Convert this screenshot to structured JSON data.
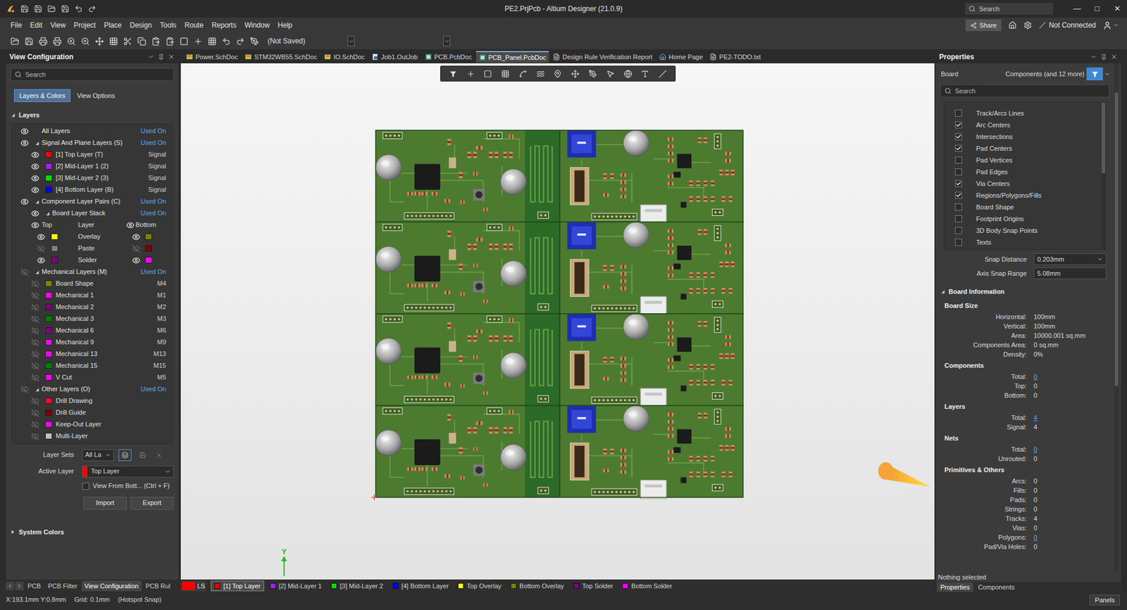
{
  "window": {
    "title": "PE2.PrjPcb - Altium Designer (21.0.9)",
    "search": "Search",
    "controls": [
      "—",
      "□",
      "✕"
    ]
  },
  "menu": [
    "File",
    "Edit",
    "View",
    "Project",
    "Place",
    "Design",
    "Tools",
    "Route",
    "Reports",
    "Window",
    "Help"
  ],
  "menu_right": {
    "share": "Share",
    "connection": "Not Connected"
  },
  "toolbar": {
    "document_state": "(Not Saved)"
  },
  "doc_tabs": [
    {
      "label": "Power.SchDoc",
      "kind": "sch",
      "selected": false
    },
    {
      "label": "STM32WB55.SchDoc",
      "kind": "sch",
      "selected": false
    },
    {
      "label": "IO.SchDoc",
      "kind": "sch",
      "selected": false
    },
    {
      "label": "Job1.OutJob",
      "kind": "outjob",
      "selected": false
    },
    {
      "label": "PCB.PcbDoc",
      "kind": "pcb",
      "selected": false
    },
    {
      "label": "PCB_Panel.PcbDoc",
      "kind": "pcb",
      "selected": true
    },
    {
      "label": "Design Rule Verification Report",
      "kind": "report",
      "selected": false
    },
    {
      "label": "Home Page",
      "kind": "home",
      "selected": false
    },
    {
      "label": "PE2-TODO.txt",
      "kind": "text",
      "selected": false
    }
  ],
  "left_panel": {
    "title": "View Configuration",
    "search": "Search",
    "tabs": [
      {
        "label": "Layers & Colors",
        "selected": true
      },
      {
        "label": "View Options",
        "selected": false
      }
    ],
    "section": {
      "label": "Layers",
      "expanded": true
    },
    "layers": [
      {
        "kind": "all",
        "name": "All Layers",
        "value": "Used On",
        "visible": true
      },
      {
        "kind": "group",
        "name": "Signal And Plane Layers (S)",
        "value": "Used On",
        "visible": true,
        "expanded": true,
        "children": [
          {
            "kind": "layer",
            "name": "[1] Top Layer (T)",
            "value": "Signal",
            "visible": true,
            "color": "#ff0000"
          },
          {
            "kind": "layer",
            "name": "[2] Mid-Layer 1 (2)",
            "value": "Signal",
            "visible": true,
            "color": "#a020f0"
          },
          {
            "kind": "layer",
            "name": "[3] Mid-Layer 2 (3)",
            "value": "Signal",
            "visible": true,
            "color": "#00e000"
          },
          {
            "kind": "layer",
            "name": "[4] Bottom Layer (B)",
            "value": "Signal",
            "visible": true,
            "color": "#0000ff"
          }
        ]
      },
      {
        "kind": "group",
        "name": "Component Layer Pairs (C)",
        "value": "Used On",
        "visible": true,
        "expanded": true,
        "children": [
          {
            "kind": "group",
            "name": "Board Layer Stack",
            "value": "Used On",
            "visible": true,
            "expanded": true,
            "children": [
              {
                "kind": "pair-header",
                "top": "Top",
                "name": "Layer",
                "bottom": "Bottom",
                "top_visible": true,
                "bottom_visible": true
              },
              {
                "kind": "pair",
                "name": "Overlay",
                "top_color": "#ffff00",
                "bottom_color": "#808000",
                "top_visible": true,
                "bottom_visible": true
              },
              {
                "kind": "pair",
                "name": "Paste",
                "top_color": "#808080",
                "bottom_color": "#800000",
                "top_visible": false,
                "bottom_visible": false
              },
              {
                "kind": "pair",
                "name": "Solder",
                "top_color": "#800080",
                "bottom_color": "#ff00ff",
                "top_visible": true,
                "bottom_visible": true
              }
            ]
          }
        ]
      },
      {
        "kind": "group",
        "name": "Mechanical Layers (M)",
        "value": "Used On",
        "visible": false,
        "expanded": true,
        "children": [
          {
            "kind": "layer",
            "name": "Board Shape",
            "value": "M4",
            "visible": false,
            "color": "#808000"
          },
          {
            "kind": "layer",
            "name": "Mechanical 1",
            "value": "M1",
            "visible": false,
            "color": "#ff00ff"
          },
          {
            "kind": "layer",
            "name": "Mechanical 2",
            "value": "M2",
            "visible": false,
            "color": "#800080"
          },
          {
            "kind": "layer",
            "name": "Mechanical 3",
            "value": "M3",
            "visible": false,
            "color": "#008000"
          },
          {
            "kind": "layer",
            "name": "Mechanical 6",
            "value": "M6",
            "visible": false,
            "color": "#800080"
          },
          {
            "kind": "layer",
            "name": "Mechanical 9",
            "value": "M9",
            "visible": false,
            "color": "#ff00ff"
          },
          {
            "kind": "layer",
            "name": "Mechanical 13",
            "value": "M13",
            "visible": false,
            "color": "#ff00ff"
          },
          {
            "kind": "layer",
            "name": "Mechanical 15",
            "value": "M15",
            "visible": false,
            "color": "#008000"
          },
          {
            "kind": "layer",
            "name": "V Cut",
            "value": "M5",
            "visible": false,
            "color": "#ff00ff"
          }
        ]
      },
      {
        "kind": "group",
        "name": "Other Layers (O)",
        "value": "Used On",
        "visible": false,
        "expanded": true,
        "children": [
          {
            "kind": "layer",
            "name": "Drill Drawing",
            "value": "",
            "visible": false,
            "color": "#ff0033"
          },
          {
            "kind": "layer",
            "name": "Drill Guide",
            "value": "",
            "visible": false,
            "color": "#800000"
          },
          {
            "kind": "layer",
            "name": "Keep-Out Layer",
            "value": "",
            "visible": false,
            "color": "#ff00ff"
          },
          {
            "kind": "layer",
            "name": "Multi-Layer",
            "value": "",
            "visible": false,
            "color": "#c0c0c0"
          }
        ]
      }
    ],
    "layer_sets": {
      "label": "Layer Sets",
      "value": "All La"
    },
    "active_layer": {
      "label": "Active Layer",
      "value": "Top Layer",
      "color": "#ff0000"
    },
    "view_from_bottom": {
      "label": "View From Bott... (Ctrl + F)",
      "checked": false
    },
    "buttons": [
      "Import",
      "Export"
    ],
    "system_colors": {
      "label": "System Colors",
      "expanded": false
    }
  },
  "canvas": {
    "axis_label": "Y"
  },
  "right_panel": {
    "title": "Properties",
    "filter_label": "Board",
    "filter_value": "Components (and 12 more)",
    "search": "Search",
    "snap_options": [
      {
        "label": "Track/Arcs Lines",
        "checked": false
      },
      {
        "label": "Arc Centers",
        "checked": true
      },
      {
        "label": "Intersections",
        "checked": true
      },
      {
        "label": "Pad Centers",
        "checked": true
      },
      {
        "label": "Pad Vertices",
        "checked": false
      },
      {
        "label": "Pad Edges",
        "checked": false
      },
      {
        "label": "Via Centers",
        "checked": true
      },
      {
        "label": "Regions/Polygons/Fills",
        "checked": true
      },
      {
        "label": "Board Shape",
        "checked": false
      },
      {
        "label": "Footprint Origins",
        "checked": false
      },
      {
        "label": "3D Body Snap Points",
        "checked": false
      },
      {
        "label": "Texts",
        "checked": false
      }
    ],
    "snap_distance": {
      "label": "Snap Distance",
      "value": "0.203mm"
    },
    "axis_snap": {
      "label": "Axis Snap Range",
      "value": "5.08mm"
    },
    "board_info": {
      "title": "Board Information",
      "expanded": true,
      "groups": [
        {
          "title": "Board Size",
          "rows": [
            {
              "label": "Horizontal:",
              "value": "100mm",
              "link": false
            },
            {
              "label": "Vertical:",
              "value": "100mm",
              "link": false
            },
            {
              "label": "Area:",
              "value": "10000.001 sq.mm",
              "link": false
            },
            {
              "label": "Components Area:",
              "value": "0 sq.mm",
              "link": false
            },
            {
              "label": "Density:",
              "value": "0%",
              "link": false
            }
          ]
        },
        {
          "title": "Components",
          "rows": [
            {
              "label": "Total:",
              "value": "0",
              "link": true
            },
            {
              "label": "Top:",
              "value": "0",
              "link": false
            },
            {
              "label": "Bottom:",
              "value": "0",
              "link": false
            }
          ]
        },
        {
          "title": "Layers",
          "rows": [
            {
              "label": "Total:",
              "value": "4",
              "link": true
            },
            {
              "label": "Signal:",
              "value": "4",
              "link": false
            }
          ]
        },
        {
          "title": "Nets",
          "rows": [
            {
              "label": "Total:",
              "value": "0",
              "link": true
            },
            {
              "label": "Unrouted:",
              "value": "0",
              "link": false
            }
          ]
        },
        {
          "title": "Primitives & Others",
          "rows": [
            {
              "label": "Arcs:",
              "value": "0",
              "link": false
            },
            {
              "label": "Fills:",
              "value": "0",
              "link": false
            },
            {
              "label": "Pads:",
              "value": "0",
              "link": false
            },
            {
              "label": "Strings:",
              "value": "0",
              "link": false
            },
            {
              "label": "Tracks:",
              "value": "4",
              "link": false
            },
            {
              "label": "Vias:",
              "value": "0",
              "link": false
            },
            {
              "label": "Polygons:",
              "value": "0",
              "link": true
            },
            {
              "label": "Pad/Via Holes:",
              "value": "0",
              "link": false
            }
          ]
        }
      ]
    },
    "status": "Nothing selected",
    "tabs": [
      {
        "label": "Properties",
        "selected": true
      },
      {
        "label": "Components",
        "selected": false
      }
    ]
  },
  "bottom_bar": {
    "panel_tabs": [
      {
        "label": "PCB",
        "selected": false
      },
      {
        "label": "PCB Filter",
        "selected": false
      },
      {
        "label": "View Configuration",
        "selected": true
      },
      {
        "label": "PCB Rul",
        "selected": false
      }
    ],
    "layer_set": {
      "label": "LS",
      "color": "#ff0000"
    },
    "layer_tabs": [
      {
        "label": "[1] Top Layer",
        "color": "#ff0000",
        "selected": true
      },
      {
        "label": "[2] Mid-Layer 1",
        "color": "#a020f0",
        "selected": false
      },
      {
        "label": "[3] Mid-Layer 2",
        "color": "#00e000",
        "selected": false
      },
      {
        "label": "[4] Bottom Layer",
        "color": "#0000ff",
        "selected": false
      },
      {
        "label": "Top Overlay",
        "color": "#ffff00",
        "selected": false
      },
      {
        "label": "Bottom Overlay",
        "color": "#808000",
        "selected": false
      },
      {
        "label": "Top Solder",
        "color": "#800080",
        "selected": false
      },
      {
        "label": "Bottom Solder",
        "color": "#ff00ff",
        "selected": false
      }
    ]
  },
  "status_bar": {
    "position": "X:193.1mm Y:0.8mm",
    "grid": "Grid: 0.1mm",
    "snap": "(Hotspot Snap)",
    "panels": "Panels"
  }
}
